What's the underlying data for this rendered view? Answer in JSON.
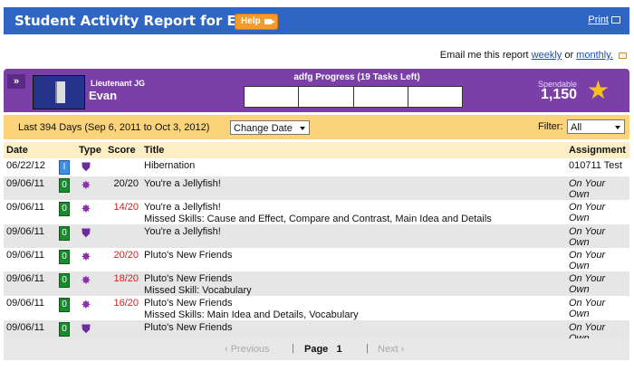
{
  "header": {
    "title": "Student Activity Report for Evan",
    "help_label": "Help",
    "print_label": "Print"
  },
  "email": {
    "prefix": "Email me this report",
    "weekly": "weekly",
    "or": "or",
    "monthly": "monthly."
  },
  "profile": {
    "rank": "Lieutenant JG",
    "name": "Evan",
    "progress_title": "adfg Progress  (19 Tasks Left)",
    "progress_segments": 4,
    "progress_fraction": 0,
    "spendable_label": "Spendable",
    "spendable_value": "1,150"
  },
  "date_bar": {
    "range": "Last 394 Days (Sep 6, 2011 to Oct 3, 2012)",
    "change_date": "Change Date",
    "filter_label": "Filter:",
    "filter_value": "All"
  },
  "table": {
    "headers": {
      "date": "Date",
      "type": "Type",
      "score": "Score",
      "title": "Title",
      "assignment": "Assignment"
    },
    "rows": [
      {
        "date": "06/22/12",
        "level": "I",
        "level_color": "blue",
        "icon": "shield-icon",
        "score": "",
        "title": "Hibernation",
        "missed": "",
        "assignment": "010711 Test",
        "assign_italic": false
      },
      {
        "date": "09/06/11",
        "level": "0",
        "level_color": "green",
        "icon": "badge-icon",
        "score": "20/20",
        "score_red": false,
        "title": "You're a Jellyfish!",
        "missed": "",
        "assignment": "On Your Own",
        "assign_italic": true
      },
      {
        "date": "09/06/11",
        "level": "0",
        "level_color": "green",
        "icon": "badge-icon",
        "score": "14/20",
        "score_red": true,
        "title": "You're a Jellyfish!",
        "missed": "Missed Skills: Cause and Effect, Compare and Contrast, Main Idea and Details",
        "assignment": "On Your Own",
        "assign_italic": true
      },
      {
        "date": "09/06/11",
        "level": "0",
        "level_color": "green",
        "icon": "shield-icon",
        "score": "",
        "title": "You're a Jellyfish!",
        "missed": "",
        "assignment": "On Your Own",
        "assign_italic": true
      },
      {
        "date": "09/06/11",
        "level": "0",
        "level_color": "green",
        "icon": "badge-icon",
        "score": "20/20",
        "score_red": true,
        "title": "Pluto's New Friends",
        "missed": "",
        "assignment": "On Your Own",
        "assign_italic": true
      },
      {
        "date": "09/06/11",
        "level": "0",
        "level_color": "green",
        "icon": "badge-icon",
        "score": "18/20",
        "score_red": true,
        "title": "Pluto's New Friends",
        "missed": "Missed Skill: Vocabulary",
        "assignment": "On Your Own",
        "assign_italic": true
      },
      {
        "date": "09/06/11",
        "level": "0",
        "level_color": "green",
        "icon": "badge-icon",
        "score": "16/20",
        "score_red": true,
        "title": "Pluto's New Friends",
        "missed": "Missed Skills: Main Idea and Details, Vocabulary",
        "assignment": "On Your Own",
        "assign_italic": true
      },
      {
        "date": "09/06/11",
        "level": "0",
        "level_color": "green",
        "icon": "shield-icon",
        "score": "",
        "title": "Pluto's New Friends",
        "missed": "",
        "assignment": "On Your Own",
        "assign_italic": true
      }
    ]
  },
  "pager": {
    "previous": "‹ Previous",
    "page_label": "Page",
    "page_number": "1",
    "next": "Next ›"
  }
}
